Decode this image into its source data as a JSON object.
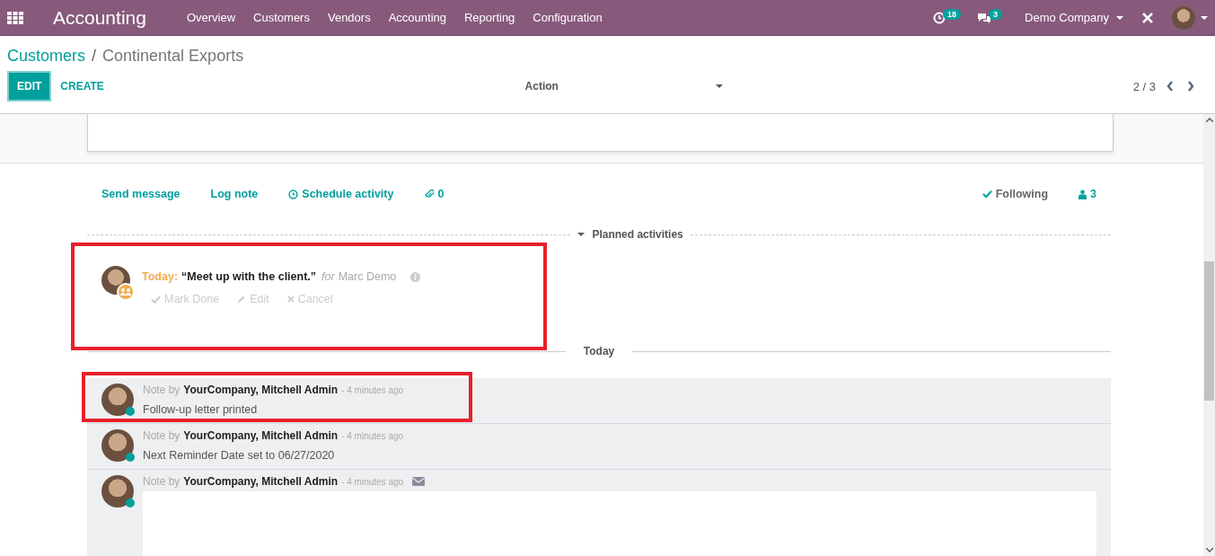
{
  "navbar": {
    "app_title": "Accounting",
    "menu": [
      "Overview",
      "Customers",
      "Vendors",
      "Accounting",
      "Reporting",
      "Configuration"
    ],
    "activity_count": "18",
    "message_count": "3",
    "company": "Demo Company"
  },
  "breadcrumb": {
    "parent": "Customers",
    "separator": "/",
    "current": "Continental Exports"
  },
  "buttons": {
    "edit": "EDIT",
    "create": "CREATE",
    "action": "Action"
  },
  "pager": "2 / 3",
  "chatter": {
    "send_message": "Send message",
    "log_note": "Log note",
    "schedule_activity": "Schedule activity",
    "attachments": "0",
    "following": "Following",
    "followers": "3"
  },
  "planned_activities": {
    "title": "Planned activities",
    "expanded": true,
    "activities": [
      {
        "due": "Today:",
        "summary": "“Meet up with the client.”",
        "for_label": "for",
        "assignee": "Marc Demo",
        "highlighted": true,
        "actions": [
          "Mark Done",
          "Edit",
          "Cancel"
        ]
      }
    ]
  },
  "date_divider": "Today",
  "messages": [
    {
      "kind": "note",
      "prefix": "Note by",
      "author": "YourCompany, Mitchell Admin",
      "time": "- 4 minutes ago",
      "body": "Follow-up letter printed",
      "highlighted": true,
      "online": true
    },
    {
      "kind": "note",
      "prefix": "Note by",
      "author": "YourCompany, Mitchell Admin",
      "time": "- 4 minutes ago",
      "body": "Next Reminder Date set to 06/27/2020",
      "highlighted": false,
      "online": true
    },
    {
      "kind": "email",
      "prefix": "Note by",
      "author": "YourCompany, Mitchell Admin",
      "time": "- 4 minutes ago",
      "highlighted": false,
      "online": true
    }
  ]
}
